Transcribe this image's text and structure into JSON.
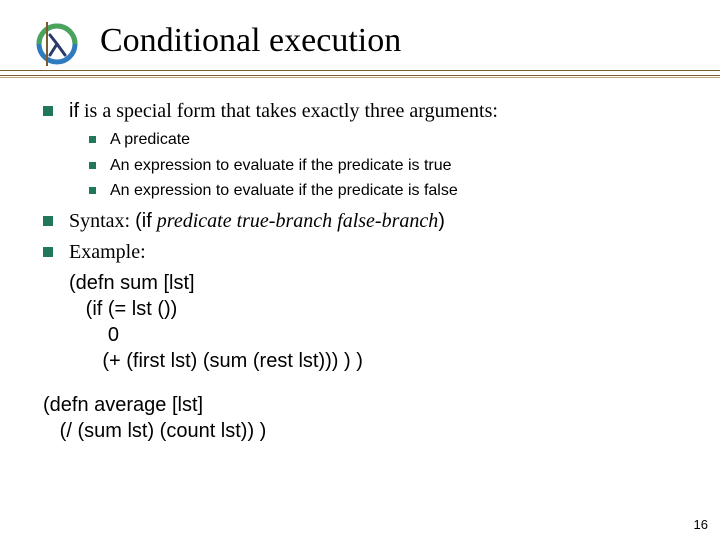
{
  "title": "Conditional execution",
  "bullets": {
    "p1_pre": "",
    "p1_kw": "if",
    "p1_post": " is a special form that takes exactly three arguments:",
    "sub": [
      "A predicate",
      "An expression to evaluate if the predicate is true",
      "An expression to evaluate if the predicate is false"
    ],
    "syntax_label": "Syntax: ",
    "syntax_open": "(",
    "syntax_if": "if",
    "syntax_space": "   ",
    "syntax_arg1": "predicate",
    "syntax_sp2": "   ",
    "syntax_arg2": "true-branch",
    "syntax_sp3": "   ",
    "syntax_arg3": "false-branch",
    "syntax_close": ")",
    "example_label": "Example:"
  },
  "code1": "(defn sum [lst]\n   (if (= lst ())\n       0\n      (+ (first lst) (sum (rest lst))) ) )",
  "code2": "(defn average [lst]\n   (/ (sum lst) (count lst)) )",
  "page_number": "16"
}
